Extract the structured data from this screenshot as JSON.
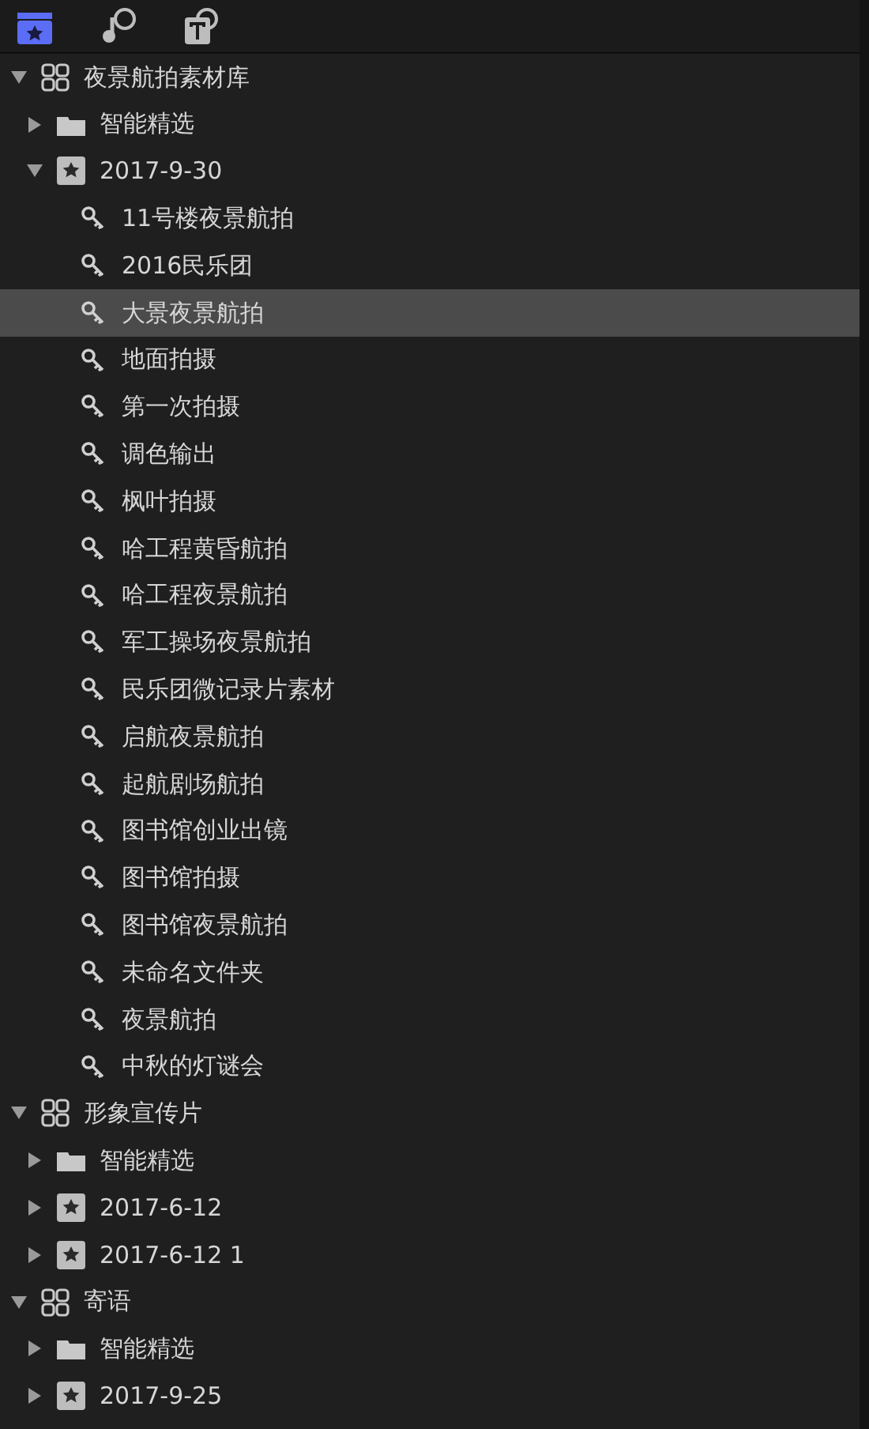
{
  "toolbar": [
    {
      "kind": "clips",
      "selected": true
    },
    {
      "kind": "audio",
      "selected": false
    },
    {
      "kind": "titles",
      "selected": false
    }
  ],
  "libraries": [
    {
      "kind": "library",
      "label": "夜景航拍素材库",
      "expanded": true,
      "selected": false,
      "children": [
        {
          "kind": "smart_collection",
          "label": "智能精选",
          "expanded": false,
          "selected": false
        },
        {
          "kind": "event",
          "label": "2017-9-30",
          "expanded": true,
          "selected": false,
          "children": [
            {
              "kind": "keyword",
              "label": "11号楼夜景航拍",
              "selected": false
            },
            {
              "kind": "keyword",
              "label": "2016民乐团",
              "selected": false
            },
            {
              "kind": "keyword",
              "label": "大景夜景航拍",
              "selected": true
            },
            {
              "kind": "keyword",
              "label": "地面拍摄",
              "selected": false
            },
            {
              "kind": "keyword",
              "label": "第一次拍摄",
              "selected": false
            },
            {
              "kind": "keyword",
              "label": "调色输出",
              "selected": false
            },
            {
              "kind": "keyword",
              "label": "枫叶拍摄",
              "selected": false
            },
            {
              "kind": "keyword",
              "label": "哈工程黄昏航拍",
              "selected": false
            },
            {
              "kind": "keyword",
              "label": "哈工程夜景航拍",
              "selected": false
            },
            {
              "kind": "keyword",
              "label": "军工操场夜景航拍",
              "selected": false
            },
            {
              "kind": "keyword",
              "label": "民乐团微记录片素材",
              "selected": false
            },
            {
              "kind": "keyword",
              "label": "启航夜景航拍",
              "selected": false
            },
            {
              "kind": "keyword",
              "label": "起航剧场航拍",
              "selected": false
            },
            {
              "kind": "keyword",
              "label": "图书馆创业出镜",
              "selected": false
            },
            {
              "kind": "keyword",
              "label": "图书馆拍摄",
              "selected": false
            },
            {
              "kind": "keyword",
              "label": "图书馆夜景航拍",
              "selected": false
            },
            {
              "kind": "keyword",
              "label": "未命名文件夹",
              "selected": false
            },
            {
              "kind": "keyword",
              "label": "夜景航拍",
              "selected": false
            },
            {
              "kind": "keyword",
              "label": "中秋的灯谜会",
              "selected": false
            }
          ]
        }
      ]
    },
    {
      "kind": "library",
      "label": "形象宣传片",
      "expanded": true,
      "selected": false,
      "children": [
        {
          "kind": "smart_collection",
          "label": "智能精选",
          "expanded": false,
          "selected": false
        },
        {
          "kind": "event",
          "label": "2017-6-12",
          "expanded": false,
          "selected": false
        },
        {
          "kind": "event",
          "label": "2017-6-12 1",
          "expanded": false,
          "selected": false
        }
      ]
    },
    {
      "kind": "library",
      "label": "寄语",
      "expanded": true,
      "selected": false,
      "children": [
        {
          "kind": "smart_collection",
          "label": "智能精选",
          "expanded": false,
          "selected": false
        },
        {
          "kind": "event",
          "label": "2017-9-25",
          "expanded": false,
          "selected": false
        }
      ]
    }
  ]
}
